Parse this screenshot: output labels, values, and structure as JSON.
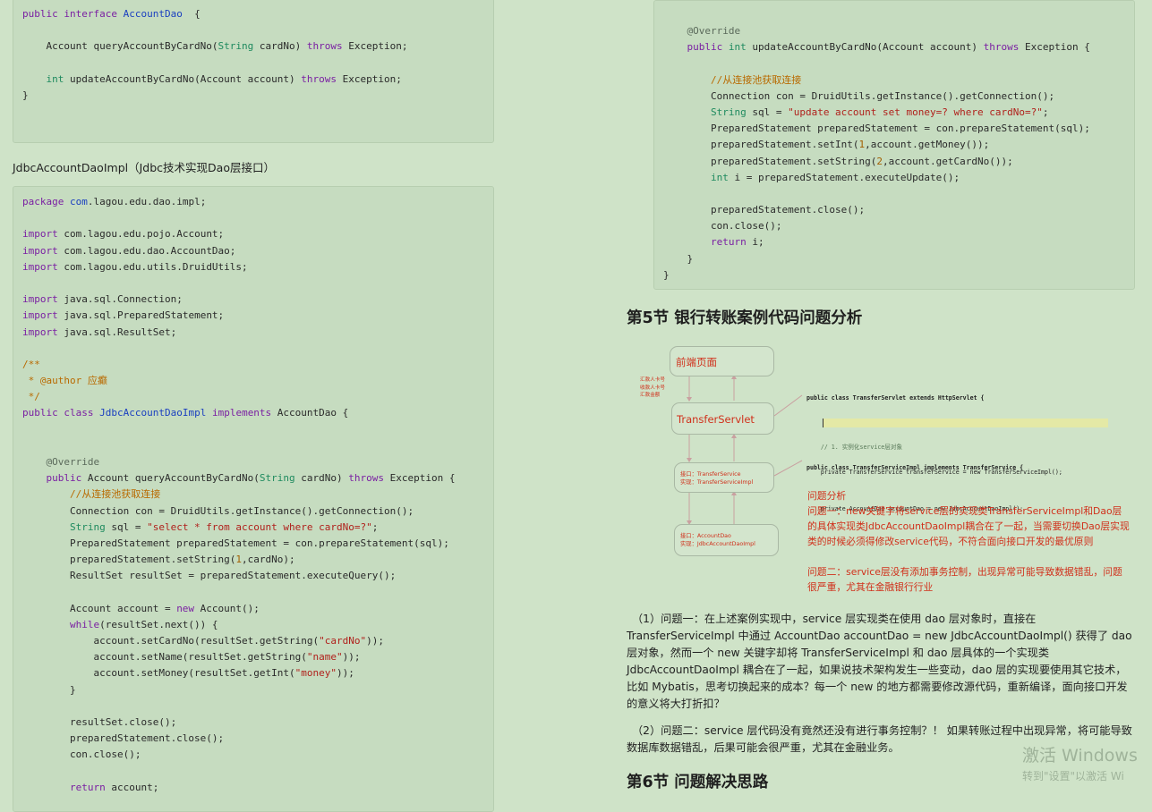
{
  "left": {
    "code1": [
      [
        [
          "kw",
          "public "
        ],
        [
          "kw",
          "interface "
        ],
        [
          "cl",
          "AccountDao"
        ],
        [
          "",
          "  {"
        ]
      ],
      [
        [
          "",
          ""
        ]
      ],
      [
        [
          "",
          "    Account queryAccountByCardNo("
        ],
        [
          "ty",
          "String"
        ],
        [
          "",
          " cardNo) "
        ],
        [
          "kw",
          "throws"
        ],
        [
          "",
          " Exception;"
        ]
      ],
      [
        [
          "",
          ""
        ]
      ],
      [
        [
          "",
          "    "
        ],
        [
          "ty",
          "int"
        ],
        [
          "",
          " updateAccountByCardNo(Account account) "
        ],
        [
          "kw",
          "throws"
        ],
        [
          "",
          " Exception;"
        ]
      ],
      [
        [
          "",
          "}"
        ]
      ]
    ],
    "label": "JdbcAccountDaoImpl（Jdbc技术实现Dao层接口）",
    "code2": [
      [
        [
          "kw",
          "package "
        ],
        [
          "cl",
          "com"
        ],
        [
          "",
          ".lagou.edu.dao.impl;"
        ]
      ],
      [
        [
          "",
          ""
        ]
      ],
      [
        [
          "kw",
          "import"
        ],
        [
          "",
          " com.lagou.edu.pojo.Account;"
        ]
      ],
      [
        [
          "kw",
          "import"
        ],
        [
          "",
          " com.lagou.edu.dao.AccountDao;"
        ]
      ],
      [
        [
          "kw",
          "import"
        ],
        [
          "",
          " com.lagou.edu.utils.DruidUtils;"
        ]
      ],
      [
        [
          "",
          ""
        ]
      ],
      [
        [
          "kw",
          "import"
        ],
        [
          "",
          " java.sql.Connection;"
        ]
      ],
      [
        [
          "kw",
          "import"
        ],
        [
          "",
          " java.sql.PreparedStatement;"
        ]
      ],
      [
        [
          "kw",
          "import"
        ],
        [
          "",
          " java.sql.ResultSet;"
        ]
      ],
      [
        [
          "",
          ""
        ]
      ],
      [
        [
          "cm",
          "/**"
        ]
      ],
      [
        [
          "cm",
          " * @author 应癫"
        ]
      ],
      [
        [
          "cm",
          " */"
        ]
      ],
      [
        [
          "kw",
          "public "
        ],
        [
          "kw",
          "class "
        ],
        [
          "cl",
          "JdbcAccountDaoImpl"
        ],
        [
          "",
          " "
        ],
        [
          "kw",
          "implements"
        ],
        [
          "",
          " AccountDao {"
        ]
      ],
      [
        [
          "",
          ""
        ]
      ],
      [
        [
          "",
          ""
        ]
      ],
      [
        [
          "an",
          "    @Override"
        ]
      ],
      [
        [
          "kw",
          "    public"
        ],
        [
          "",
          " Account queryAccountByCardNo("
        ],
        [
          "ty",
          "String"
        ],
        [
          "",
          " cardNo) "
        ],
        [
          "kw",
          "throws"
        ],
        [
          "",
          " Exception {"
        ]
      ],
      [
        [
          "cm",
          "        //从连接池获取连接"
        ]
      ],
      [
        [
          "",
          "        Connection con = DruidUtils.getInstance().getConnection();"
        ]
      ],
      [
        [
          "ty",
          "        String"
        ],
        [
          "",
          " sql = "
        ],
        [
          "st",
          "\"select * from account where cardNo=?\""
        ],
        [
          "",
          ";"
        ]
      ],
      [
        [
          "",
          "        PreparedStatement preparedStatement = con.prepareStatement(sql);"
        ]
      ],
      [
        [
          "",
          "        preparedStatement.setString("
        ],
        [
          "nb",
          "1"
        ],
        [
          "",
          ",cardNo);"
        ]
      ],
      [
        [
          "",
          "        ResultSet resultSet = preparedStatement.executeQuery();"
        ]
      ],
      [
        [
          "",
          ""
        ]
      ],
      [
        [
          "",
          "        Account account = "
        ],
        [
          "kw",
          "new"
        ],
        [
          "",
          " Account();"
        ]
      ],
      [
        [
          "kw",
          "        while"
        ],
        [
          "",
          "(resultSet.next()) {"
        ]
      ],
      [
        [
          "",
          "            account.setCardNo(resultSet.getString("
        ],
        [
          "st",
          "\"cardNo\""
        ],
        [
          "",
          "));"
        ]
      ],
      [
        [
          "",
          "            account.setName(resultSet.getString("
        ],
        [
          "st",
          "\"name\""
        ],
        [
          "",
          "));"
        ]
      ],
      [
        [
          "",
          "            account.setMoney(resultSet.getInt("
        ],
        [
          "st",
          "\"money\""
        ],
        [
          "",
          "));"
        ]
      ],
      [
        [
          "",
          "        }"
        ]
      ],
      [
        [
          "",
          ""
        ]
      ],
      [
        [
          "",
          "        resultSet.close();"
        ]
      ],
      [
        [
          "",
          "        preparedStatement.close();"
        ]
      ],
      [
        [
          "",
          "        con.close();"
        ]
      ],
      [
        [
          "",
          ""
        ]
      ],
      [
        [
          "kw",
          "        return"
        ],
        [
          "",
          " account;"
        ]
      ]
    ]
  },
  "right": {
    "code3": [
      [
        [
          "an",
          "    @Override"
        ]
      ],
      [
        [
          "kw",
          "    public "
        ],
        [
          "ty",
          "int"
        ],
        [
          "",
          " updateAccountByCardNo(Account account) "
        ],
        [
          "kw",
          "throws"
        ],
        [
          "",
          " Exception {"
        ]
      ],
      [
        [
          "",
          ""
        ]
      ],
      [
        [
          "cm",
          "        //从连接池获取连接"
        ]
      ],
      [
        [
          "",
          "        Connection con = DruidUtils.getInstance().getConnection();"
        ]
      ],
      [
        [
          "ty",
          "        String"
        ],
        [
          "",
          " sql = "
        ],
        [
          "st",
          "\"update account set money=? where cardNo=?\""
        ],
        [
          "",
          ";"
        ]
      ],
      [
        [
          "",
          "        PreparedStatement preparedStatement = con.prepareStatement(sql);"
        ]
      ],
      [
        [
          "",
          "        preparedStatement.setInt("
        ],
        [
          "nb",
          "1"
        ],
        [
          "",
          ",account.getMoney());"
        ]
      ],
      [
        [
          "",
          "        preparedStatement.setString("
        ],
        [
          "nb",
          "2"
        ],
        [
          "",
          ",account.getCardNo());"
        ]
      ],
      [
        [
          "ty",
          "        int"
        ],
        [
          "",
          " i = preparedStatement.executeUpdate();"
        ]
      ],
      [
        [
          "",
          ""
        ]
      ],
      [
        [
          "",
          "        preparedStatement.close();"
        ]
      ],
      [
        [
          "",
          "        con.close();"
        ]
      ],
      [
        [
          "kw",
          "        return"
        ],
        [
          "",
          " i;"
        ]
      ],
      [
        [
          "",
          "    }"
        ]
      ],
      [
        [
          "",
          "}"
        ]
      ]
    ],
    "heading5": "第5节 银行转账案例代码问题分析",
    "diagram": {
      "box_frontend": "前端页面",
      "box_servlet": "TransferServlet",
      "box_service_line1": "接口：TransferService",
      "box_service_line2": "实现：TransferServiceImpl",
      "box_dao_line1": "接口：AccountDao",
      "box_dao_line2": "实现：JdbcAccountDaoImpl",
      "side_labels": [
        "汇款人卡号",
        "收款人卡号",
        "汇款金额"
      ],
      "servlet_code": [
        "public class TransferServlet extends HttpServlet {",
        "",
        "    // 1. 实例化service层对象",
        "    private TransferService transferService = new TransferServiceImpl();"
      ],
      "service_code": [
        "public class TransferServiceImpl implements TransferService {",
        "",
        "    private AccountDao accountDao = new JdbcAccountDaoImpl();"
      ],
      "analysis_title": "问题分析",
      "analysis_p1": "问题一：new关键字将service层的实现类TransferServiceImpl和Dao层的具体实现类JdbcAccountDaoImpl耦合在了一起，当需要切换Dao层实现类的时候必须得修改service代码，不符合面向接口开发的最优原则",
      "analysis_p2": "问题二：service层没有添加事务控制，出现异常可能导致数据错乱，问题很严重，尤其在金融银行行业"
    },
    "para1": "（1）问题一：在上述案例实现中，service 层实现类在使用 dao 层对象时，直接在 TransferServiceImpl 中通过 AccountDao accountDao = new JdbcAccountDaoImpl() 获得了 dao层对象，然而一个 new 关键字却将 TransferServiceImpl 和 dao 层具体的一个实现类 JdbcAccountDaoImpl 耦合在了一起，如果说技术架构发生一些变动，dao 层的实现要使用其它技术，比如 Mybatis，思考切换起来的成本？每一个 new 的地方都需要修改源代码，重新编译，面向接口开发的意义将大打折扣？",
    "para2": "（2）问题二：service 层代码没有竟然还没有进行事务控制？！ 如果转账过程中出现异常，将可能导致数据库数据错乱，后果可能会很严重，尤其在金融业务。",
    "heading6": "第6节 问题解决思路"
  },
  "watermark": {
    "line1": "激活 Windows",
    "line2": "转到\"设置\"以激活 Wi"
  },
  "colors": {
    "page_bg": "#cfe3c8",
    "code_bg": "#c6dcc0",
    "keyword": "#7a1fa2",
    "type": "#1e8a5e",
    "string": "#b0211c",
    "comment": "#b96a00",
    "diagram_red": "#d0301b"
  }
}
